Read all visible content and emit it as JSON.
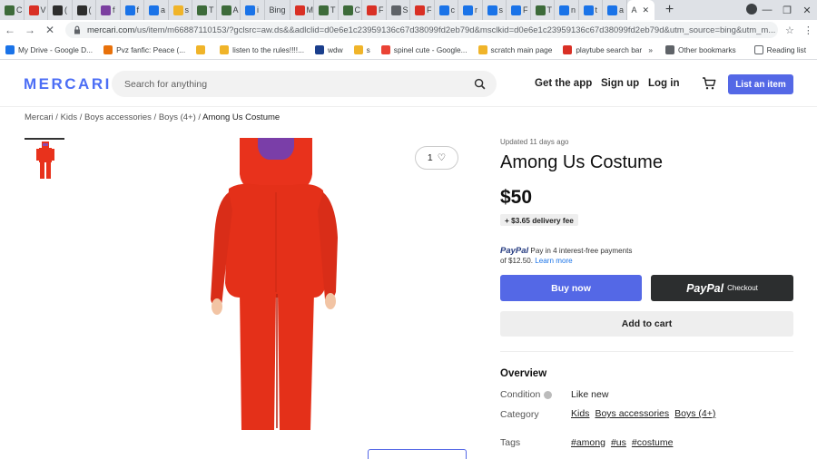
{
  "browser": {
    "tabs": [
      {
        "label": "C",
        "color": "#3d6b3a"
      },
      {
        "label": "V",
        "color": "#d93025"
      },
      {
        "label": "(",
        "color": "#2d2d2d"
      },
      {
        "label": "(",
        "color": "#2d2d2d"
      },
      {
        "label": "f",
        "color": "#7b3fa0"
      },
      {
        "label": "f",
        "color": "#1a73e8"
      },
      {
        "label": "a",
        "color": "#1a73e8"
      },
      {
        "label": "s",
        "color": "#f0b429"
      },
      {
        "label": "T",
        "color": "#3d6b3a"
      },
      {
        "label": "A",
        "color": "#3d6b3a"
      },
      {
        "label": "i",
        "color": "#1a73e8"
      },
      {
        "label": "Bing",
        "color": "#ffffff"
      },
      {
        "label": "M",
        "color": "#d93025"
      },
      {
        "label": "T",
        "color": "#3d6b3a"
      },
      {
        "label": "C",
        "color": "#3d6b3a"
      },
      {
        "label": "F",
        "color": "#d93025"
      },
      {
        "label": "S",
        "color": "#5f6368"
      },
      {
        "label": "F",
        "color": "#d93025"
      },
      {
        "label": "c",
        "color": "#1a73e8"
      },
      {
        "label": "r",
        "color": "#1a73e8"
      },
      {
        "label": "s",
        "color": "#1a73e8"
      },
      {
        "label": "F",
        "color": "#1a73e8"
      },
      {
        "label": "T",
        "color": "#3d6b3a"
      },
      {
        "label": "n",
        "color": "#1a73e8"
      },
      {
        "label": "t",
        "color": "#1a73e8"
      },
      {
        "label": "a",
        "color": "#1a73e8"
      }
    ],
    "active_tab_label": "A",
    "url_host": "mercari.com",
    "url_path": "/us/item/m66887110153/?gclsrc=aw.ds&&adlclid=d0e6e1c23959136c67d38099fd2eb79d&msclkid=d0e6e1c23959136c67d38099fd2eb79d&utm_source=bing&utm_m...",
    "bookmarks": [
      {
        "label": "My Drive - Google D...",
        "color": "#1a73e8"
      },
      {
        "label": "Pvz fanfic: Peace (...",
        "color": "#e8710a"
      },
      {
        "label": "",
        "color": "#f0b429"
      },
      {
        "label": "listen to the rules!!!!...",
        "color": "#f0b429"
      },
      {
        "label": "wdw",
        "color": "#1a3e8c"
      },
      {
        "label": "s",
        "color": "#f0b429"
      },
      {
        "label": "spinel cute - Google...",
        "color": "#ea4335"
      },
      {
        "label": "scratch main page",
        "color": "#f0b429"
      },
      {
        "label": "playtube search bar",
        "color": "#d93025"
      }
    ],
    "other_bookmarks": "Other bookmarks",
    "reading_list": "Reading list"
  },
  "header": {
    "logo": "MERCARI",
    "search_placeholder": "Search for anything",
    "get_app": "Get the app",
    "sign_up": "Sign up",
    "log_in": "Log in",
    "list_item": "List an item"
  },
  "breadcrumb": {
    "items": [
      "Mercari",
      "Kids",
      "Boys accessories",
      "Boys (4+)"
    ],
    "current": "Among Us Costume"
  },
  "gallery": {
    "like_count": "1"
  },
  "product": {
    "updated": "Updated 11 days ago",
    "title": "Among Us Costume",
    "price": "$50",
    "shipping": "+ $3.65 delivery fee",
    "paypal_brand": "PayPal",
    "paypal_text": "Pay in 4 interest-free payments",
    "paypal_text2": "of $12.50.",
    "paypal_link": "Learn more",
    "buy_now": "Buy now",
    "paypal_checkout_brand": "PayPal",
    "paypal_checkout_text": "Checkout",
    "add_to_cart": "Add to cart"
  },
  "overview": {
    "heading": "Overview",
    "condition_label": "Condition",
    "condition_value": "Like new",
    "category_label": "Category",
    "categories": [
      "Kids",
      "Boys accessories",
      "Boys (4+)"
    ],
    "tags_label": "Tags",
    "tags": [
      "#among",
      "#us",
      "#costume"
    ]
  },
  "colors": {
    "brand": "#4c6ef5",
    "button": "#5468e6",
    "costume_red": "#e8321c"
  }
}
